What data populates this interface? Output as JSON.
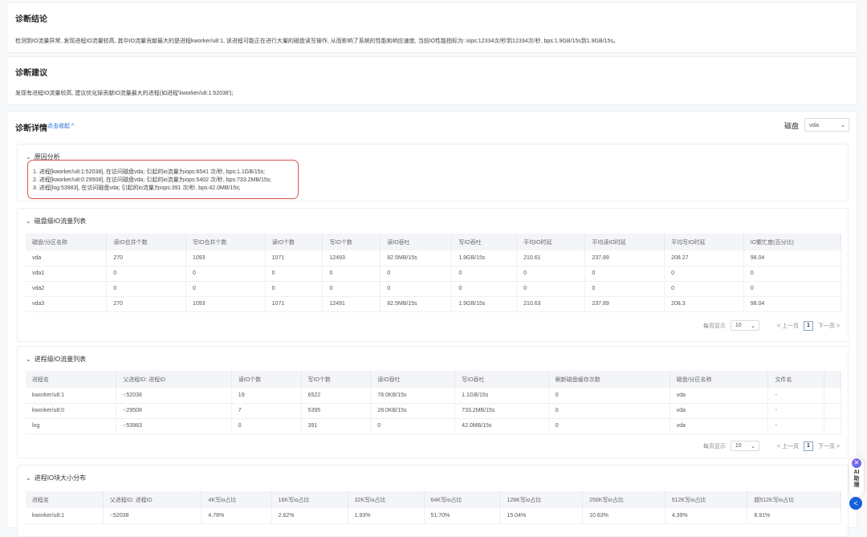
{
  "conclusion": {
    "title": "诊断结论",
    "text": "检测到IO流量异常, 发现进程IO流量较高, 其中IO流量贡献最大的是进程kworker/u8:1, 该进程可能正在进行大量的磁盘读写操作, 从而影响了系统的性能和响应速度, 当前IO性能指标为: iops:12334次/秒到12334次/秒, bps:1.9GB/15s到1.9GB/15s。"
  },
  "suggestion": {
    "title": "诊断建议",
    "text": "发现有进程IO流量较高, 建议优化掉贡献IO流量最大的进程(如进程'kworker/u8:1:52038');"
  },
  "details": {
    "title": "诊断详情",
    "collapse_link": "点击收起 ^",
    "disk_label": "磁盘",
    "disk_value": "vda"
  },
  "cause": {
    "title": "原因分析",
    "highlight_color": "#d9534f",
    "items": [
      "1. 进程[kworker/u8:1:52038], 在访问磁盘vda; 引起的io流量为iops:6541 次/秒, bps:1.1GB/15s;",
      "2. 进程[kworker/u8:0:29508], 在访问磁盘vda; 引起的io流量为iops:5402 次/秒, bps:733.2MB/15s;",
      "3. 进程[log:53983], 在访问磁盘vda; 引起的io流量为iops:391 次/秒, bps:42.0MB/15s;"
    ]
  },
  "disk_table": {
    "title": "磁盘级IO流量列表",
    "columns": [
      "磁盘/分区名称",
      "读IO合并个数",
      "写IO合并个数",
      "读IO个数",
      "写IO个数",
      "读IO吞吐",
      "写IO吞吐",
      "平均IO时延",
      "平均读IO时延",
      "平均写IO时延",
      "IO繁忙度(百分比)"
    ],
    "rows": [
      [
        "vda",
        "270",
        "1093",
        "1071",
        "12493",
        "82.5MB/15s",
        "1.9GB/15s",
        "210.61",
        "237.89",
        "208.27",
        "98.04"
      ],
      [
        "vda1",
        "0",
        "0",
        "0",
        "0",
        "0",
        "0",
        "0",
        "0",
        "0",
        "0"
      ],
      [
        "vda2",
        "0",
        "0",
        "0",
        "0",
        "0",
        "0",
        "0",
        "0",
        "0",
        "0"
      ],
      [
        "vda3",
        "270",
        "1093",
        "1071",
        "12491",
        "82.5MB/15s",
        "1.9GB/15s",
        "210.63",
        "237.89",
        "208.3",
        "98.04"
      ]
    ]
  },
  "proc_table": {
    "title": "进程级IO流量列表",
    "columns": [
      "进程名",
      "父进程ID: 进程ID",
      "读IO个数",
      "写IO个数",
      "读IO吞吐",
      "写IO吞吐",
      "刷新磁盘缓存次数",
      "磁盘/分区名称",
      "文件名",
      ""
    ],
    "rows": [
      [
        "kworker/u8:1",
        "-:52038",
        "19",
        "6522",
        "76.0KB/15s",
        "1.1GB/15s",
        "0",
        "vda",
        "-",
        ""
      ],
      [
        "kworker/u8:0",
        "-:29508",
        "7",
        "5395",
        "28.0KB/15s",
        "733.2MB/15s",
        "0",
        "vda",
        "-",
        ""
      ],
      [
        "log",
        "-:53983",
        "0",
        "391",
        "0",
        "42.0MB/15s",
        "0",
        "vda",
        "-",
        ""
      ]
    ]
  },
  "block_table": {
    "title": "进程IO块大小分布",
    "columns": [
      "进程名",
      "父进程ID: 进程ID",
      "4K写io占比",
      "16K写io占比",
      "32K写io占比",
      "64K写io占比",
      "128K写io占比",
      "256K写io占比",
      "512K写io占比",
      "超512K写io占比"
    ],
    "rows": [
      [
        "kworker/u8:1",
        "-:52038",
        "4.78%",
        "2.62%",
        "1.93%",
        "51.70%",
        "15.04%",
        "10.63%",
        "4.39%",
        "8.91%"
      ]
    ]
  },
  "pager": {
    "page_size_label": "每页显示",
    "page_size": "10",
    "prev": "< 上一页",
    "page": "1",
    "next": "下一页 >"
  },
  "assistant": {
    "label_1": "AI",
    "label_2": "助",
    "label_3": "理",
    "collapse_icon": "<"
  }
}
